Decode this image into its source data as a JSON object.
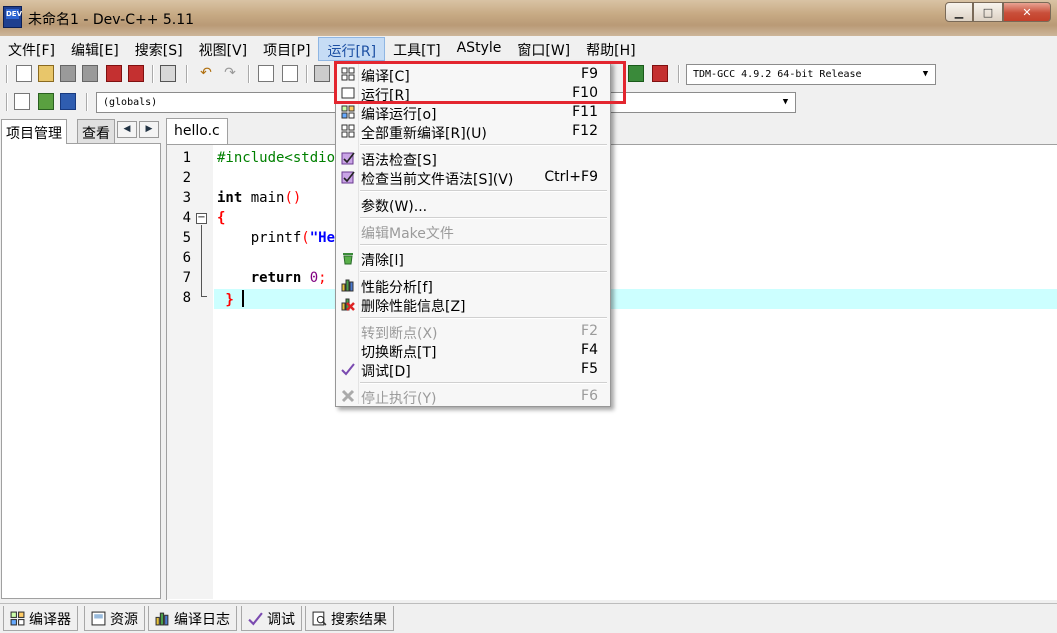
{
  "window": {
    "title": "未命名1 - Dev-C++ 5.11",
    "icon_text": "DEV",
    "controls": [
      "minimize-icon",
      "maximize-icon",
      "close-icon"
    ]
  },
  "menubar": {
    "items": [
      "文件[F]",
      "编辑[E]",
      "搜索[S]",
      "视图[V]",
      "项目[P]",
      "运行[R]",
      "工具[T]",
      "AStyle",
      "窗口[W]",
      "帮助[H]"
    ],
    "active_index": 5
  },
  "toolbar": {
    "compiler_select": "TDM-GCC 4.9.2 64-bit Release",
    "scope_select": "(globals)"
  },
  "left_panel": {
    "tabs": [
      "项目管理",
      "查看类"
    ]
  },
  "editor": {
    "tab": "hello.c",
    "line_numbers": [
      "1",
      "2",
      "3",
      "4",
      "5",
      "6",
      "7",
      "8"
    ],
    "lines": {
      "l1": "#include<stdio.h>",
      "l3_kw": "int",
      "l3_rest": " main",
      "l3_paren": "()",
      "l4": "{",
      "l5_fn": "    printf",
      "l5_paren": "(",
      "l5_str": "\"He",
      "l7_kw": "    return",
      "l7_num": " 0",
      "l7_semi": ";",
      "l8": " }"
    }
  },
  "run_menu": {
    "items": [
      {
        "label": "编译[C]",
        "shortcut": "F9",
        "icon": "compile-icon"
      },
      {
        "label": "运行[R]",
        "shortcut": "F10",
        "icon": "run-icon"
      },
      {
        "label": "编译运行[o]",
        "shortcut": "F11",
        "icon": "compile-run-icon"
      },
      {
        "label": "全部重新编译[R](U)",
        "shortcut": "F12",
        "icon": "rebuild-all-icon"
      },
      {
        "label": "语法检查[S]",
        "shortcut": "",
        "icon": "syntax-check-icon"
      },
      {
        "label": "检查当前文件语法[S](V)",
        "shortcut": "Ctrl+F9",
        "icon": "syntax-check-file-icon"
      },
      {
        "label": "参数(W)...",
        "shortcut": "",
        "icon": ""
      },
      {
        "label": "编辑Make文件",
        "shortcut": "",
        "icon": "",
        "disabled": true
      },
      {
        "label": "清除[l]",
        "shortcut": "",
        "icon": "clean-icon"
      },
      {
        "label": "性能分析[f]",
        "shortcut": "",
        "icon": "profile-icon"
      },
      {
        "label": "删除性能信息[Z]",
        "shortcut": "",
        "icon": "delete-profile-icon"
      },
      {
        "label": "转到断点(X)",
        "shortcut": "F2",
        "icon": "",
        "disabled": true
      },
      {
        "label": "切换断点[T]",
        "shortcut": "F4",
        "icon": ""
      },
      {
        "label": "调试[D]",
        "shortcut": "F5",
        "icon": "debug-check-icon"
      },
      {
        "label": "停止执行(Y)",
        "shortcut": "F6",
        "icon": "stop-icon",
        "disabled": true
      }
    ],
    "highlight_color": "#e3262f"
  },
  "bottom_tabs": [
    "编译器",
    "资源",
    "编译日志",
    "调试",
    "搜索结果"
  ]
}
